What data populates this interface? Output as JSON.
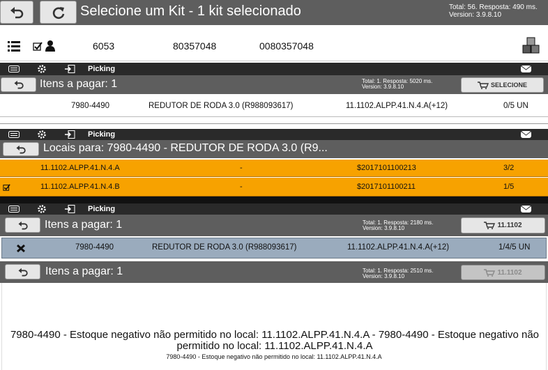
{
  "screen1": {
    "title": "Selecione um Kit - 1 kit selecionado",
    "meta_total": "Total: 56. Resposta: 490 ms.",
    "meta_version": "Version: 3.9.8.10",
    "row": {
      "c1": "6053",
      "c2": "80357048",
      "c3": "0080357048"
    }
  },
  "nav_label": "Picking",
  "screen2": {
    "title": "Itens a pagar: 1",
    "meta_total": "Total: 1. Resposta: 5020 ms.",
    "meta_version": "Version: 3.9.8.10",
    "button": "SELECIONE",
    "row": {
      "code": "7980-4490",
      "desc": "REDUTOR DE RODA 3.0 (R988093617)",
      "loc": "11.1102.ALPP.41.N.4.A(+12)",
      "qty": "0/5 UN"
    }
  },
  "screen3": {
    "title": "Locais para: 7980-4490 - REDUTOR DE RODA 3.0 (R9...",
    "rows": [
      {
        "loc": "11.1102.ALPP.41.N.4.A",
        "dash": "-",
        "serial": "$2017101100213",
        "qty": "3/2"
      },
      {
        "loc": "11.1102.ALPP.41.N.4.B",
        "dash": "-",
        "serial": "$2017101100211",
        "qty": "1/5"
      }
    ]
  },
  "screen4": {
    "title": "Itens a pagar: 1",
    "meta_total": "Total: 1. Resposta: 2180 ms.",
    "meta_version": "Version: 3.9.8.10",
    "button": "11.1102",
    "row": {
      "code": "7980-4490",
      "desc": "REDUTOR DE RODA 3.0 (R988093617)",
      "loc": "11.1102.ALPP.41.N.4.A(+12)",
      "qty": "1/4/5 UN"
    }
  },
  "screen5": {
    "title": "Itens a pagar: 1",
    "meta_total": "Total: 1. Resposta: 2510 ms.",
    "meta_version": "Version: 3.9.8.10",
    "button": "11.1102",
    "error_big": "7980-4490 - Estoque negativo não permitido no local: 11.1102.ALPP.41.N.4.A - 7980-4490 - Estoque negativo não permitido no local: 11.1102.ALPP.41.N.4.A",
    "error_small": "7980-4490 - Estoque negativo não permitido no local: 11.1102.ALPP.41.N.4.A"
  },
  "icons": {
    "back": "back-arrow-icon",
    "refresh": "refresh-icon",
    "list": "list-icon",
    "check": "checkbox-icon",
    "user": "user-icon",
    "boxes": "boxes-icon",
    "menu": "menu-icon",
    "settings": "gear-icon",
    "exit": "exit-icon",
    "cart": "cart-icon",
    "mail": "mail-icon",
    "close": "close-icon"
  },
  "colors": {
    "header": "#5e5e5e",
    "nav": "#2a2a2a",
    "orange": "#f7a200",
    "selected_row": "#9aabbd"
  }
}
